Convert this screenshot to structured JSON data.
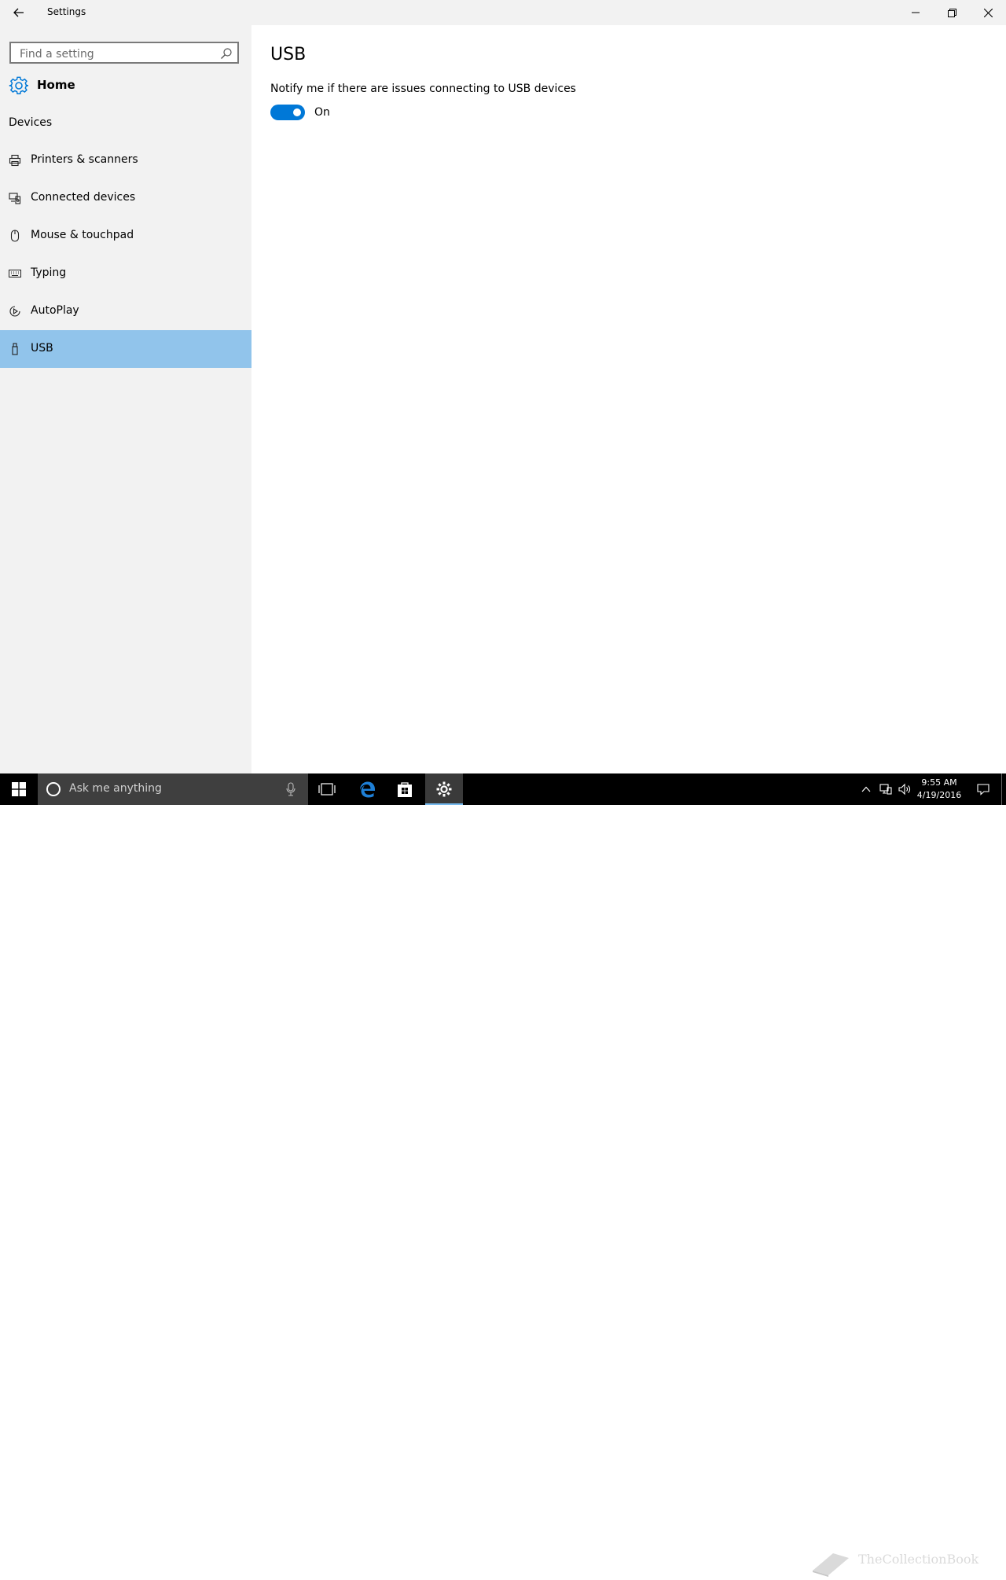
{
  "window": {
    "title": "Settings",
    "back_icon": "back-arrow-icon",
    "controls": [
      "minimize-icon",
      "restore-icon",
      "close-icon"
    ]
  },
  "sidebar": {
    "search_placeholder": "Find a setting",
    "home_label": "Home",
    "section_label": "Devices",
    "items": [
      {
        "label": "Printers & scanners",
        "icon": "printer-icon"
      },
      {
        "label": "Connected devices",
        "icon": "connected-devices-icon"
      },
      {
        "label": "Mouse & touchpad",
        "icon": "mouse-icon"
      },
      {
        "label": "Typing",
        "icon": "keyboard-icon"
      },
      {
        "label": "AutoPlay",
        "icon": "autoplay-icon"
      },
      {
        "label": "USB",
        "icon": "usb-icon",
        "selected": true
      }
    ]
  },
  "main": {
    "heading": "USB",
    "setting_label": "Notify me if there are issues connecting to USB devices",
    "toggle_state": "On",
    "toggle_on": true
  },
  "taskbar": {
    "search_placeholder": "Ask me anything",
    "time": "9:55 AM",
    "date": "4/19/2016",
    "watermark": "TheCollectionBook"
  },
  "colors": {
    "accent": "#0078d7",
    "selected_nav": "#91c4eb",
    "sidebar_bg": "#f2f2f2",
    "taskbar_bg": "#000000"
  }
}
